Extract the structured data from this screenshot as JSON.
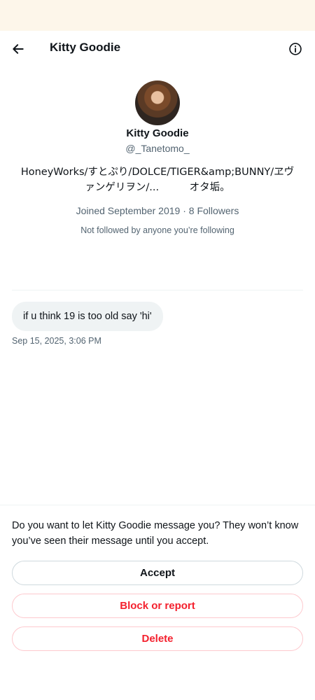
{
  "header": {
    "title": "Kitty Goodie"
  },
  "profile": {
    "name": "Kitty Goodie",
    "handle": "@_Tanetomo_",
    "bio_line1": "HoneyWorks/すとぷり/DOLCE/TIGER&amp;BUNNY/ヱヴ",
    "bio_line2": "ァンゲリヲン/...　　　オタ垢。",
    "joined": "Joined September 2019",
    "separator": "·",
    "followers": "8 Followers",
    "not_followed": "Not followed by anyone you’re following"
  },
  "conversation": {
    "message_text": "if u think 19 is too old say 'hi'",
    "message_time": "Sep 15, 2025, 3:06 PM"
  },
  "request": {
    "prompt": "Do you want to let Kitty Goodie message you? They won’t know you’ve seen their message until you accept.",
    "accept_label": "Accept",
    "block_label": "Block or report",
    "delete_label": "Delete"
  },
  "icons": {
    "back": "arrow-left-icon",
    "info": "info-icon"
  },
  "colors": {
    "text_primary": "#0f1419",
    "text_secondary": "#536471",
    "danger": "#f4212e",
    "bubble": "#eff3f4",
    "status_strip": "#fdf6ea"
  }
}
